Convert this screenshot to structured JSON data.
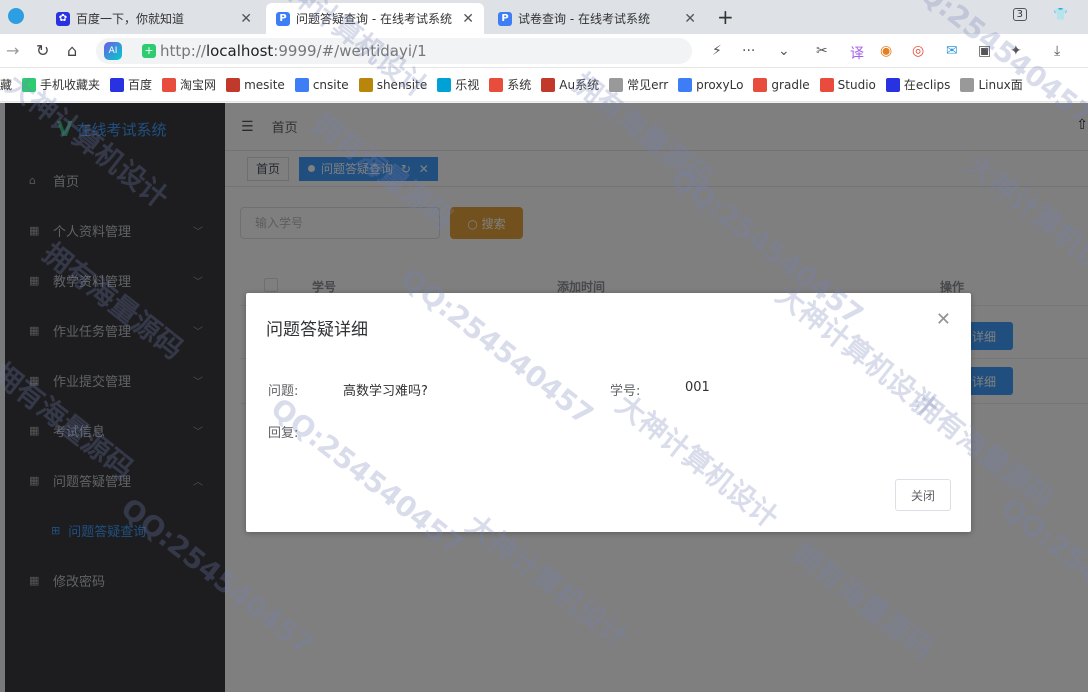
{
  "browser": {
    "tabs": [
      {
        "label": "百度一下，你就知道",
        "icon": "baidu-paw-icon",
        "active": false
      },
      {
        "label": "问题答疑查询 - 在线考试系统",
        "icon": "p-logo-icon",
        "active": true
      },
      {
        "label": "试卷查询 - 在线考试系统",
        "icon": "p-logo-icon",
        "active": false
      }
    ],
    "tab_count": "3",
    "url_host": "http://",
    "url_domain": "localhost",
    "url_rest": ":9999/#/wentidayi/1",
    "bookmarks": [
      "藏",
      "手机收藏夹",
      "百度",
      "淘宝网",
      "mesite",
      "cnsite",
      "shensite",
      "乐视",
      "系统",
      "Au系统",
      "常见err",
      "proxyLo",
      "gradle",
      "Studio",
      "在eclips",
      "Linux面"
    ]
  },
  "sidebar": {
    "logo": "在线考试系统",
    "items": [
      {
        "label": "首页",
        "icon": "home-icon"
      },
      {
        "label": "个人资料管理",
        "icon": "grid-icon"
      },
      {
        "label": "教学资料管理",
        "icon": "grid-icon"
      },
      {
        "label": "作业任务管理",
        "icon": "grid-icon"
      },
      {
        "label": "作业提交管理",
        "icon": "grid-icon"
      },
      {
        "label": "考试信息",
        "icon": "grid-icon"
      },
      {
        "label": "问题答疑管理",
        "icon": "grid-icon"
      },
      {
        "label": "问题答疑查询",
        "icon": "grid-icon"
      },
      {
        "label": "修改密码",
        "icon": "grid-icon"
      }
    ]
  },
  "header": {
    "breadcrumb": "首页"
  },
  "tags": {
    "home": "首页",
    "current": "问题答疑查询"
  },
  "search": {
    "placeholder": "输入学号",
    "button": "搜索"
  },
  "table": {
    "columns": [
      "学号",
      "添加时间",
      "操作"
    ],
    "detail_label": "详细"
  },
  "dialog": {
    "title": "问题答疑详细",
    "question_label": "问题:",
    "question_value": "高数学习难吗?",
    "student_label": "学号:",
    "student_value": "001",
    "reply_label": "回复:",
    "reply_value": "",
    "close_label": "关闭"
  },
  "watermark": {
    "texts": [
      "大神计算机设计",
      "拥有海量源码",
      "QQ:254540457"
    ]
  }
}
